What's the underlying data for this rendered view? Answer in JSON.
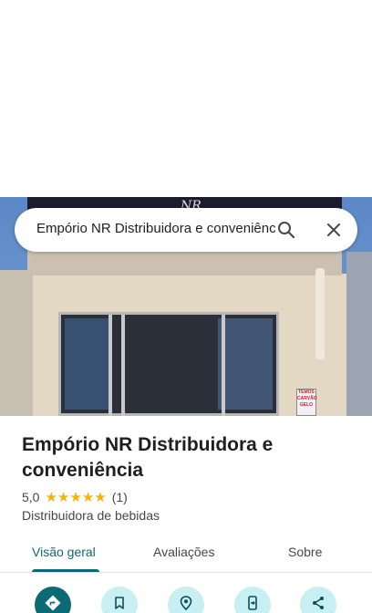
{
  "search": {
    "query": "Empório NR Distribuidora e conveniência"
  },
  "photo": {
    "sign_text": "NR",
    "poster_text": "TEMOS CARVÃO GELO"
  },
  "place": {
    "name": "Empório NR Distribuidora e conveniência",
    "rating": "5,0",
    "stars": [
      "★",
      "★",
      "★",
      "★",
      "★"
    ],
    "review_count": "(1)",
    "category": "Distribuidora de bebidas"
  },
  "tabs": [
    {
      "label": "Visão geral",
      "active": true
    },
    {
      "label": "Avaliações",
      "active": false
    },
    {
      "label": "Sobre",
      "active": false
    }
  ],
  "actions": [
    {
      "icon": "directions-icon"
    },
    {
      "icon": "bookmark-icon"
    },
    {
      "icon": "nearby-icon"
    },
    {
      "icon": "send-to-phone-icon"
    },
    {
      "icon": "share-icon"
    }
  ],
  "colors": {
    "accent": "#0b6a74",
    "button_bg": "#c8eff2",
    "star": "#f4b400"
  }
}
